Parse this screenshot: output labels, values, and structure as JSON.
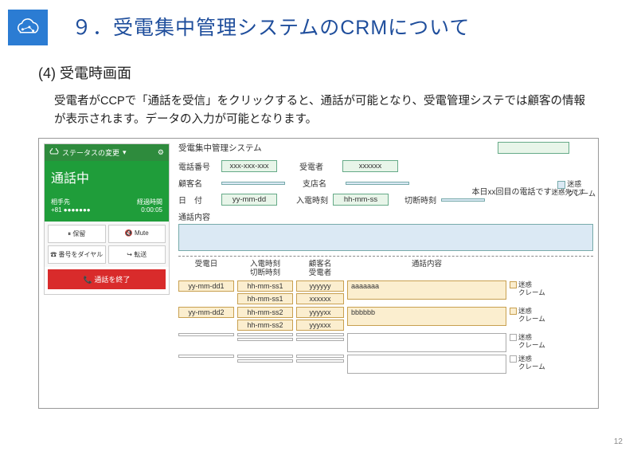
{
  "header": {
    "title": "９．受電集中管理システムのCRMについて",
    "subtitle": "(4) 受電時画面",
    "description": "受電者がCCPで「通話を受信」をクリックすると、通話が可能となり、受電管理システでは顧客の情報が表示されます。データの入力が可能となります。"
  },
  "ccp": {
    "status_change": "ステータスの変更",
    "status": "通話中",
    "caller_label": "相手先",
    "caller": "+81 ●●●●●●●",
    "elapsed_label": "経過時間",
    "elapsed": "0:00:05",
    "btn_hold": "保留",
    "btn_mute": "Mute",
    "btn_dial": "番号をダイヤル",
    "btn_transfer": "転送",
    "btn_end": "通話を終了"
  },
  "form": {
    "system_name": "受電集中管理システム",
    "labels": {
      "phone": "電話番号",
      "receiver": "受電者",
      "customer": "顧客名",
      "branch": "支店名",
      "date": "日　付",
      "in_time": "入電時刻",
      "cut_time": "切断時刻",
      "content": "通話内容"
    },
    "values": {
      "phone": "xxx-xxx-xxx",
      "receiver": "xxxxxx",
      "date": "yy-mm-dd",
      "in_time": "hh-mm-ss"
    },
    "note_prefix": "本日xx回目の電話です",
    "note_suffix": "迷惑先です",
    "flag_meiwaku": "迷惑",
    "flag_claim": "クレーム"
  },
  "history": {
    "headers": {
      "date": "受電日",
      "times": "入電時刻\n切断時刻",
      "who": "顧客名\n受電者",
      "content": "通話内容"
    },
    "rows": [
      {
        "date": "yy-mm-dd1",
        "t1": "hh-mm-ss1",
        "t2": "hh-mm-ss1",
        "w1": "yyyyyy",
        "w2": "xxxxxx",
        "content": "aaaaaaa"
      },
      {
        "date": "yy-mm-dd2",
        "t1": "hh-mm-ss2",
        "t2": "hh-mm-ss2",
        "w1": "yyyyxx",
        "w2": "yyyxxx",
        "content": "bbbbbb"
      },
      {
        "date": "",
        "t1": "",
        "t2": "",
        "w1": "",
        "w2": "",
        "content": ""
      },
      {
        "date": "",
        "t1": "",
        "t2": "",
        "w1": "",
        "w2": "",
        "content": ""
      }
    ],
    "flag_meiwaku": "迷惑",
    "flag_claim": "クレーム"
  },
  "page_number": "12"
}
